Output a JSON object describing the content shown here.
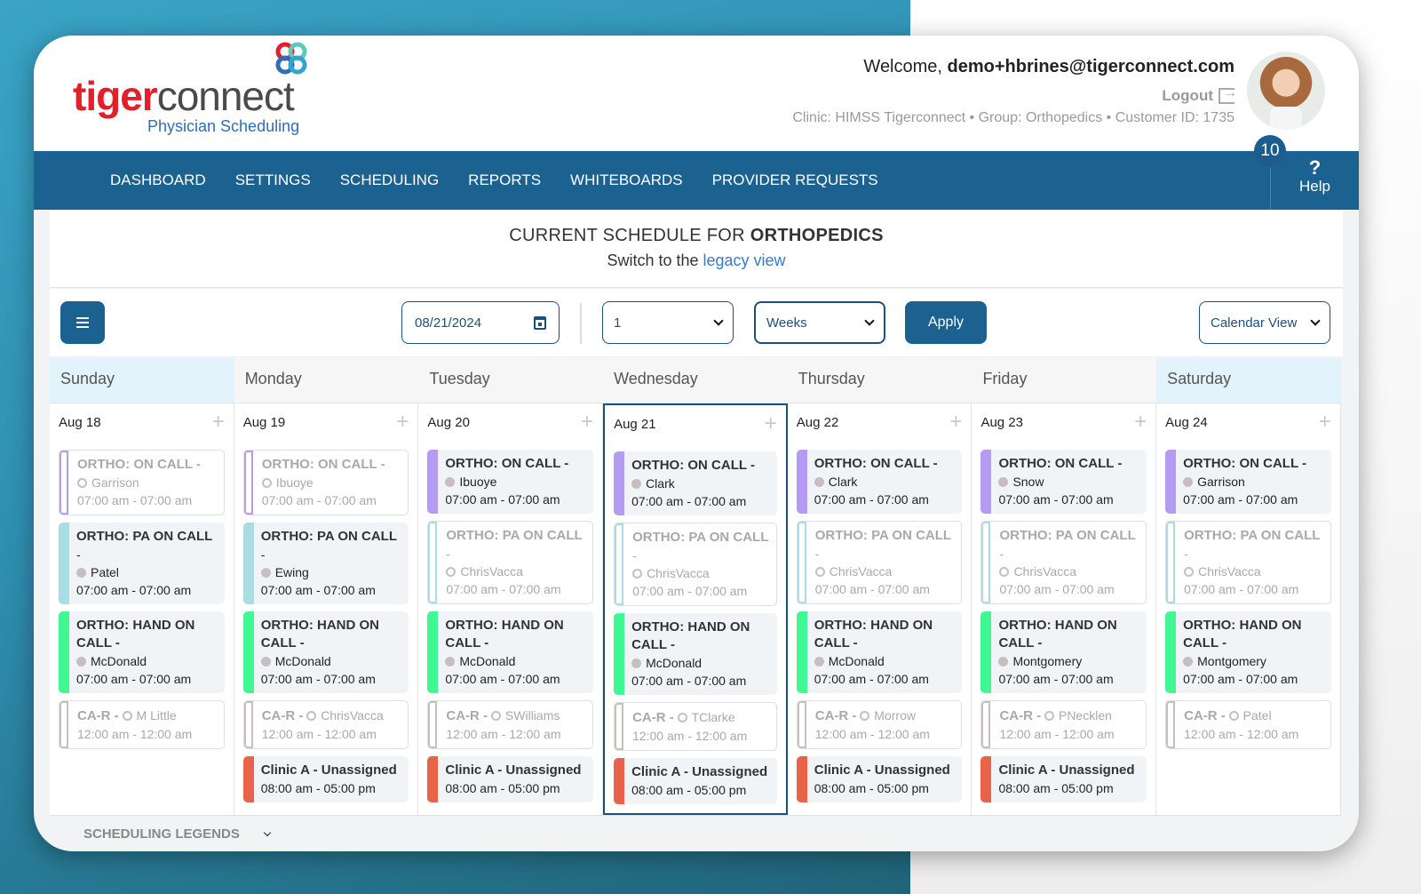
{
  "colors": {
    "primary": "#1b6290",
    "on_call": "#b39cf2",
    "pa_on_call": "#a9dde3",
    "hand_on_call": "#3ff793",
    "ca_r": "#c7bfbe",
    "clinic": "#e8634a",
    "link": "#2e7dd8",
    "logo_red": "#e2202c"
  },
  "brand": {
    "logo_part1": "tiger",
    "logo_part2": "connect",
    "subtitle": "Physician Scheduling"
  },
  "user": {
    "welcome_prefix": "Welcome, ",
    "email": "demo+hbrines@tigerconnect.com",
    "logout_label": "Logout",
    "clinic_info": "Clinic: HIMSS Tigerconnect • Group: Orthopedics • Customer ID: 1735",
    "notification_count": "10"
  },
  "nav": {
    "items": [
      "DASHBOARD",
      "SETTINGS",
      "SCHEDULING",
      "REPORTS",
      "WHITEBOARDS",
      "PROVIDER REQUESTS"
    ],
    "help_icon": "?",
    "help_label": "Help"
  },
  "page": {
    "title_prefix": "CURRENT SCHEDULE FOR ",
    "title_group": "ORTHOPEDICS",
    "switch_prefix": "Switch to the ",
    "switch_link": "legacy view"
  },
  "toolbar": {
    "date_value": "08/21/2024",
    "count_value": "1",
    "unit_value": "Weeks",
    "apply_label": "Apply",
    "view_value": "Calendar View"
  },
  "calendar": {
    "days": [
      {
        "name": "Sunday",
        "date": "Aug 18",
        "weekend": true,
        "today": false,
        "shifts": [
          {
            "type": "on_call",
            "style": "outline",
            "title": "ORTHO: ON CALL -",
            "person": "Garrison",
            "time": "07:00 am - 07:00 am"
          },
          {
            "type": "pa_on_call",
            "style": "filled",
            "title": "ORTHO: PA ON CALL",
            "dash": "-",
            "person": "Patel",
            "time": "07:00 am - 07:00 am"
          },
          {
            "type": "hand_on_call",
            "style": "filled",
            "title": "ORTHO: HAND ON CALL -",
            "person": "McDonald",
            "time": "07:00 am - 07:00 am"
          },
          {
            "type": "ca_r",
            "style": "outline",
            "title": "CA-R -",
            "person": "M Little",
            "time": "12:00 am - 12:00 am",
            "inline": true
          }
        ]
      },
      {
        "name": "Monday",
        "date": "Aug 19",
        "weekend": false,
        "today": false,
        "shifts": [
          {
            "type": "on_call",
            "style": "outline",
            "title": "ORTHO: ON CALL -",
            "person": "Ibuoye",
            "time": "07:00 am - 07:00 am"
          },
          {
            "type": "pa_on_call",
            "style": "filled",
            "title": "ORTHO: PA ON CALL",
            "dash": "-",
            "person": "Ewing",
            "time": "07:00 am - 07:00 am"
          },
          {
            "type": "hand_on_call",
            "style": "filled",
            "title": "ORTHO: HAND ON CALL -",
            "person": "McDonald",
            "time": "07:00 am - 07:00 am"
          },
          {
            "type": "ca_r",
            "style": "outline",
            "title": "CA-R -",
            "person": "ChrisVacca",
            "time": "12:00 am - 12:00 am",
            "inline": true
          },
          {
            "type": "clinic",
            "style": "filled",
            "title": "Clinic A - Unassigned",
            "time": "08:00 am - 05:00 pm"
          }
        ]
      },
      {
        "name": "Tuesday",
        "date": "Aug 20",
        "weekend": false,
        "today": false,
        "shifts": [
          {
            "type": "on_call",
            "style": "filled",
            "title": "ORTHO: ON CALL -",
            "person": "Ibuoye",
            "time": "07:00 am - 07:00 am"
          },
          {
            "type": "pa_on_call",
            "style": "outline",
            "title": "ORTHO: PA ON CALL",
            "dash": "-",
            "person": "ChrisVacca",
            "time": "07:00 am - 07:00 am"
          },
          {
            "type": "hand_on_call",
            "style": "filled",
            "title": "ORTHO: HAND ON CALL -",
            "person": "McDonald",
            "time": "07:00 am - 07:00 am"
          },
          {
            "type": "ca_r",
            "style": "outline",
            "title": "CA-R -",
            "person": "SWilliams",
            "time": "12:00 am - 12:00 am",
            "inline": true
          },
          {
            "type": "clinic",
            "style": "filled",
            "title": "Clinic A - Unassigned",
            "time": "08:00 am - 05:00 pm"
          }
        ]
      },
      {
        "name": "Wednesday",
        "date": "Aug 21",
        "weekend": false,
        "today": true,
        "shifts": [
          {
            "type": "on_call",
            "style": "filled",
            "title": "ORTHO: ON CALL -",
            "person": "Clark",
            "time": "07:00 am - 07:00 am"
          },
          {
            "type": "pa_on_call",
            "style": "outline",
            "title": "ORTHO: PA ON CALL",
            "dash": "-",
            "person": "ChrisVacca",
            "time": "07:00 am - 07:00 am"
          },
          {
            "type": "hand_on_call",
            "style": "filled",
            "title": "ORTHO: HAND ON CALL -",
            "person": "McDonald",
            "time": "07:00 am - 07:00 am"
          },
          {
            "type": "ca_r",
            "style": "outline",
            "title": "CA-R -",
            "person": "TClarke",
            "time": "12:00 am - 12:00 am",
            "inline": true
          },
          {
            "type": "clinic",
            "style": "filled",
            "title": "Clinic A - Unassigned",
            "time": "08:00 am - 05:00 pm"
          }
        ]
      },
      {
        "name": "Thursday",
        "date": "Aug 22",
        "weekend": false,
        "today": false,
        "shifts": [
          {
            "type": "on_call",
            "style": "filled",
            "title": "ORTHO: ON CALL -",
            "person": "Clark",
            "time": "07:00 am - 07:00 am"
          },
          {
            "type": "pa_on_call",
            "style": "outline",
            "title": "ORTHO: PA ON CALL",
            "dash": "-",
            "person": "ChrisVacca",
            "time": "07:00 am - 07:00 am"
          },
          {
            "type": "hand_on_call",
            "style": "filled",
            "title": "ORTHO: HAND ON CALL -",
            "person": "McDonald",
            "time": "07:00 am - 07:00 am"
          },
          {
            "type": "ca_r",
            "style": "outline",
            "title": "CA-R -",
            "person": "Morrow",
            "time": "12:00 am - 12:00 am",
            "inline": true
          },
          {
            "type": "clinic",
            "style": "filled",
            "title": "Clinic A - Unassigned",
            "time": "08:00 am - 05:00 pm"
          }
        ]
      },
      {
        "name": "Friday",
        "date": "Aug 23",
        "weekend": false,
        "today": false,
        "shifts": [
          {
            "type": "on_call",
            "style": "filled",
            "title": "ORTHO: ON CALL -",
            "person": "Snow",
            "time": "07:00 am - 07:00 am"
          },
          {
            "type": "pa_on_call",
            "style": "outline",
            "title": "ORTHO: PA ON CALL",
            "dash": "-",
            "person": "ChrisVacca",
            "time": "07:00 am - 07:00 am"
          },
          {
            "type": "hand_on_call",
            "style": "filled",
            "title": "ORTHO: HAND ON CALL -",
            "person": "Montgomery",
            "time": "07:00 am - 07:00 am"
          },
          {
            "type": "ca_r",
            "style": "outline",
            "title": "CA-R -",
            "person": "PNecklen",
            "time": "12:00 am - 12:00 am",
            "inline": true
          },
          {
            "type": "clinic",
            "style": "filled",
            "title": "Clinic A - Unassigned",
            "time": "08:00 am - 05:00 pm"
          }
        ]
      },
      {
        "name": "Saturday",
        "date": "Aug 24",
        "weekend": true,
        "today": false,
        "shifts": [
          {
            "type": "on_call",
            "style": "filled",
            "title": "ORTHO: ON CALL -",
            "person": "Garrison",
            "time": "07:00 am - 07:00 am"
          },
          {
            "type": "pa_on_call",
            "style": "outline",
            "title": "ORTHO: PA ON CALL",
            "dash": "-",
            "person": "ChrisVacca",
            "time": "07:00 am - 07:00 am"
          },
          {
            "type": "hand_on_call",
            "style": "filled",
            "title": "ORTHO: HAND ON CALL -",
            "person": "Montgomery",
            "time": "07:00 am - 07:00 am"
          },
          {
            "type": "ca_r",
            "style": "outline",
            "title": "CA-R -",
            "person": "Patel",
            "time": "12:00 am - 12:00 am",
            "inline": true
          }
        ]
      }
    ]
  },
  "legends": {
    "label": "SCHEDULING LEGENDS"
  }
}
